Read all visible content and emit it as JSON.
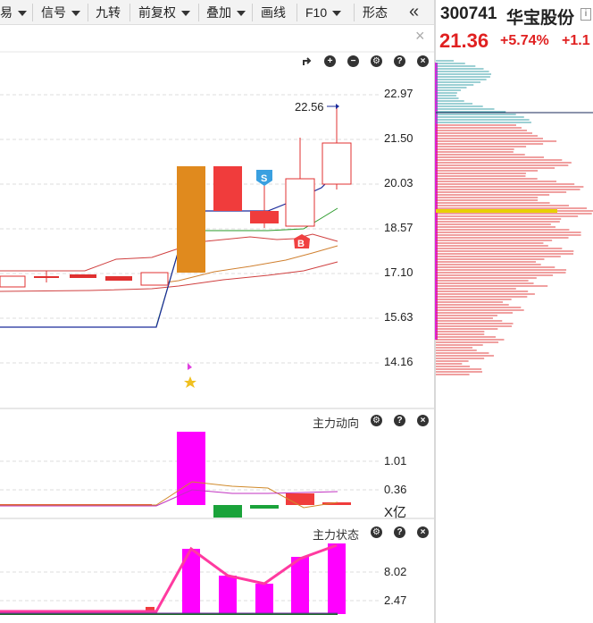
{
  "toolbar": {
    "items": [
      "易",
      "信号",
      "九转",
      "前复权",
      "叠加",
      "画线",
      "F10",
      "形态"
    ],
    "collapse_glyph": "«",
    "close_glyph": "×"
  },
  "main_chart": {
    "y_ticks": [
      "22.97",
      "21.50",
      "20.03",
      "18.57",
      "17.10",
      "15.63",
      "14.16"
    ],
    "high_label": "22.56",
    "sell_marker": "S",
    "buy_marker": "B"
  },
  "panel_flow": {
    "title": "主力动向",
    "y_ticks": [
      "1.01",
      "0.36"
    ],
    "unit": "X亿"
  },
  "panel_state": {
    "title": "主力状态",
    "y_ticks": [
      "8.02",
      "2.47"
    ]
  },
  "quote": {
    "code": "300741",
    "name": "华宝股份",
    "price": "21.36",
    "pct_change": "+5.74%",
    "change": "+1.1",
    "info_glyph": "i"
  },
  "colors": {
    "up": "#f03c3c",
    "down": "#1aa33a",
    "accent_orange": "#e08a1e",
    "magenta": "#ff00ff",
    "price_red": "#e02020",
    "teal": "#3aa0a8"
  }
}
